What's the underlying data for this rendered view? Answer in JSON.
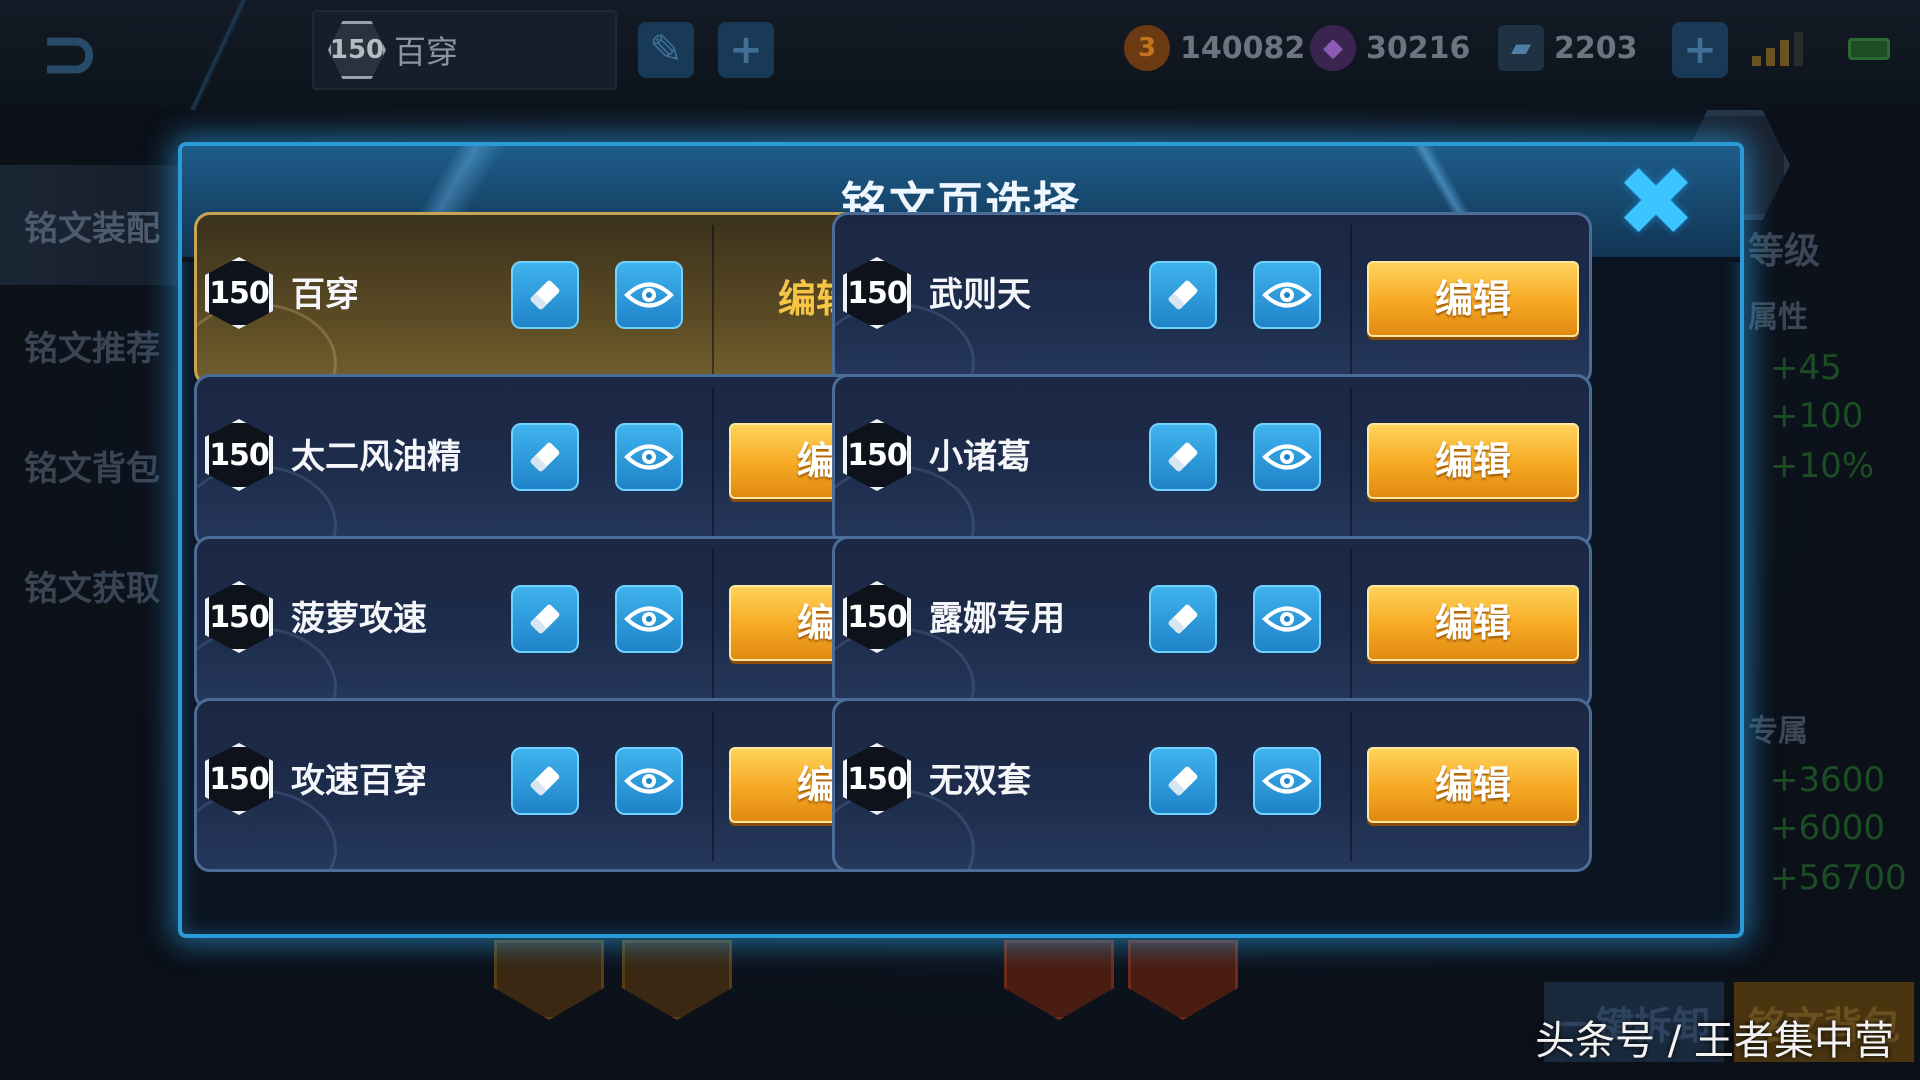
{
  "topbar": {
    "current_page": {
      "level": "150",
      "name": "百穿"
    },
    "currencies": [
      {
        "icon": "gold-coin-icon",
        "value": "140082",
        "color": "#c4741c"
      },
      {
        "icon": "diamond-icon",
        "value": "30216",
        "color": "#8c5bb5"
      },
      {
        "icon": "voucher-icon",
        "value": "2203",
        "color": "#4f7fa3"
      }
    ]
  },
  "side_nav": {
    "items": [
      {
        "label": "铭文装配"
      },
      {
        "label": "铭文推荐"
      },
      {
        "label": "铭文背包"
      },
      {
        "label": "铭文获取"
      }
    ]
  },
  "right_panel": {
    "level_label": "等级",
    "attr_label": "属性",
    "attr_values": [
      "+45",
      "+100",
      "+10%"
    ],
    "belong_label": "专属",
    "belong_values": [
      "+3600",
      "+6000",
      "+56700"
    ]
  },
  "bottom": {
    "dismantle_label": "一键拆卸",
    "bag_label": "铭文背包"
  },
  "modal": {
    "title": "铭文页选择",
    "edit_label": "编辑",
    "editing_label": "编辑中",
    "pages": [
      {
        "level": "150",
        "name": "百穿",
        "active": true
      },
      {
        "level": "150",
        "name": "武则天",
        "active": false
      },
      {
        "level": "150",
        "name": "太二风油精",
        "active": false
      },
      {
        "level": "150",
        "name": "小诸葛",
        "active": false
      },
      {
        "level": "150",
        "name": "菠萝攻速",
        "active": false
      },
      {
        "level": "150",
        "name": "露娜专用",
        "active": false
      },
      {
        "level": "150",
        "name": "攻速百穿",
        "active": false
      },
      {
        "level": "150",
        "name": "无双套",
        "active": false
      }
    ]
  },
  "watermark": "头条号 / 王者集中营",
  "colors": {
    "accent_blue": "#2c9ad6",
    "edit_orange": "#f6a823",
    "editing_gold": "#f7c546"
  }
}
